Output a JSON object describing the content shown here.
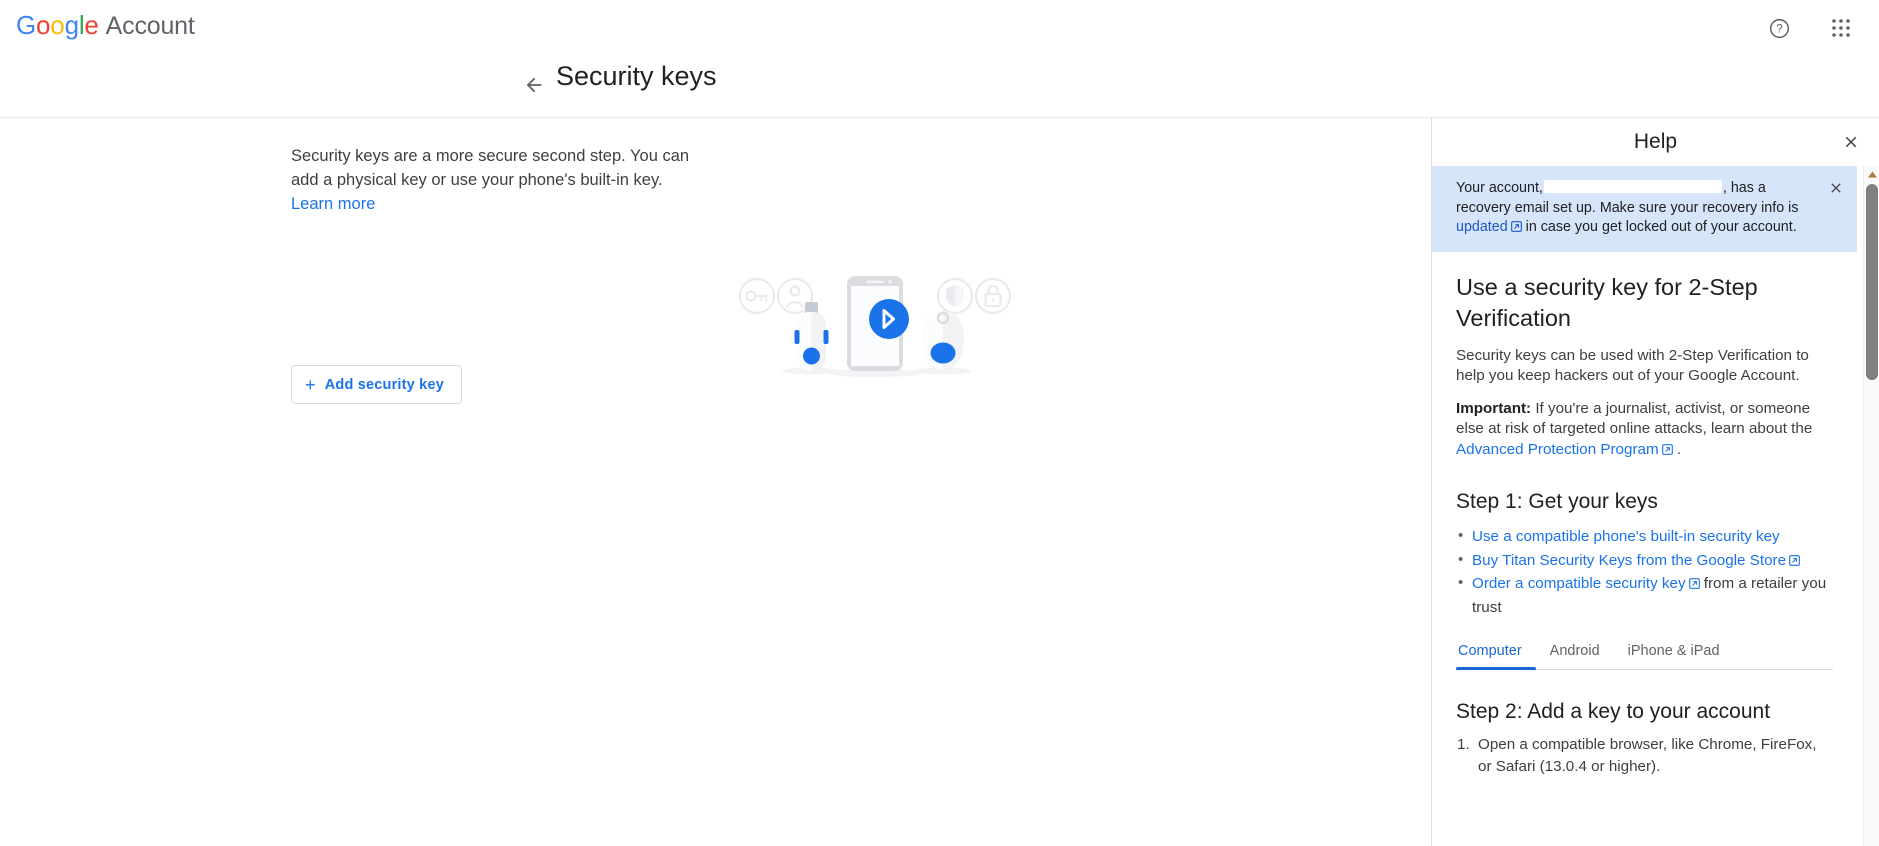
{
  "topbar": {
    "brand_word": "Google",
    "brand_letters": [
      "G",
      "o",
      "o",
      "g",
      "l",
      "e"
    ],
    "brand_suffix": "Account",
    "help_icon": "help-circle-icon",
    "apps_icon": "apps-grid-icon"
  },
  "page": {
    "back_icon": "arrow-left-icon",
    "title": "Security keys"
  },
  "main": {
    "description": "Security keys are a more secure second step. You can add a physical key or use your phone's built-in key.",
    "learn_more_label": "Learn more",
    "add_key_button": "Add security key",
    "add_key_plus": "+",
    "illustration": {
      "name": "security-keys-illustration",
      "items": [
        "key-circle-icon",
        "account-circle-icon",
        "usb-security-key",
        "phone-with-bluetooth",
        "bluetooth-badge-icon",
        "key-fob",
        "shield-circle-icon",
        "lock-circle-icon"
      ],
      "accent_color": "#1a73e8",
      "muted_color": "#e8eaed"
    }
  },
  "help": {
    "title": "Help",
    "close_icon": "close-icon",
    "banner": {
      "text_before": "Your account,",
      "redacted_value": "",
      "text_after": ", has a recovery email set up. Make sure your recovery info is ",
      "link_label": "updated",
      "text_end": " in case you get locked out of your account.",
      "close_icon": "close-icon",
      "background": "#d7e5fa"
    },
    "article_title": "Use a security key for 2-Step Verification",
    "intro": "Security keys can be used with 2-Step Verification to help you keep hackers out of your Google Account.",
    "important_label": "Important:",
    "important_text": " If you're a journalist, activist, or someone else at risk of targeted online attacks, learn about the ",
    "important_link": "Advanced Protection Program",
    "important_end": " .",
    "step1_title": "Step 1: Get your keys",
    "step1_items": [
      {
        "link": "Use a compatible phone's built-in security key",
        "external": false,
        "trailing": ""
      },
      {
        "link": "Buy Titan Security Keys from the Google Store",
        "external": true,
        "trailing": ""
      },
      {
        "link": "Order a compatible security key",
        "external": true,
        "trailing": " from a retailer you trust"
      }
    ],
    "tabs": [
      {
        "label": "Computer",
        "active": true
      },
      {
        "label": "Android",
        "active": false
      },
      {
        "label": "iPhone & iPad",
        "active": false
      }
    ],
    "step2_title": "Step 2: Add a key to your account",
    "step2_items": [
      {
        "num": "1.",
        "text": "Open a compatible browser, like Chrome, FireFox, or Safari (13.0.4 or higher)."
      }
    ],
    "scrollbar": {
      "up_icon": "scroll-up-arrow-icon",
      "thumb": "scroll-thumb"
    }
  },
  "colors": {
    "link": "#1a73e8",
    "accent": "#1967d2",
    "text": "#202124",
    "text_secondary": "#3c4043",
    "border": "#dadce0"
  }
}
